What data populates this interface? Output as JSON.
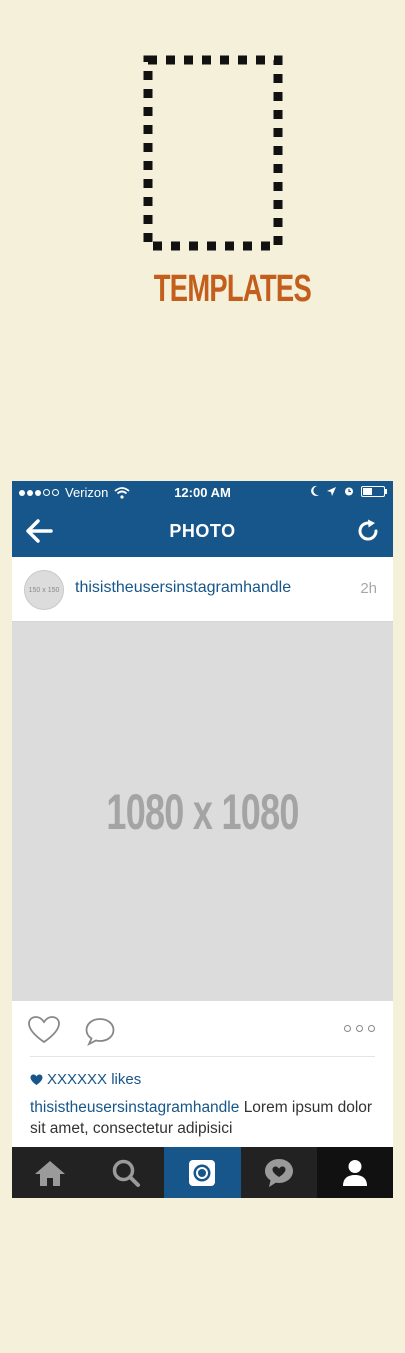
{
  "logo": {
    "title": "TEMPLATES",
    "color": "#c35e1c"
  },
  "status_bar": {
    "carrier": "Verizon",
    "time": "12:00 AM",
    "signal_dots_filled": 3,
    "signal_dots_total": 5,
    "battery_level": 0.45
  },
  "nav": {
    "title": "PHOTO",
    "back_icon": "arrow-left-icon",
    "refresh_icon": "refresh-icon"
  },
  "post": {
    "avatar_label": "150 x 150",
    "username": "thisistheusersinstagramhandle",
    "timestamp": "2h",
    "photo_label": "1080 x 1080",
    "likes": "XXXXXX likes",
    "caption_user": "thisistheusersinstagramhandle",
    "caption_text": "Lorem ipsum dolor sit amet, consectetur adipisici"
  },
  "tabs": [
    {
      "name": "home",
      "icon": "home-icon"
    },
    {
      "name": "search",
      "icon": "search-icon"
    },
    {
      "name": "camera",
      "icon": "camera-icon",
      "active": true
    },
    {
      "name": "activity",
      "icon": "activity-heart-icon"
    },
    {
      "name": "profile",
      "icon": "profile-icon"
    }
  ],
  "colors": {
    "brand_blue": "#16568a",
    "background": "#f4f0da",
    "placeholder_gray": "#dcdcdc"
  }
}
